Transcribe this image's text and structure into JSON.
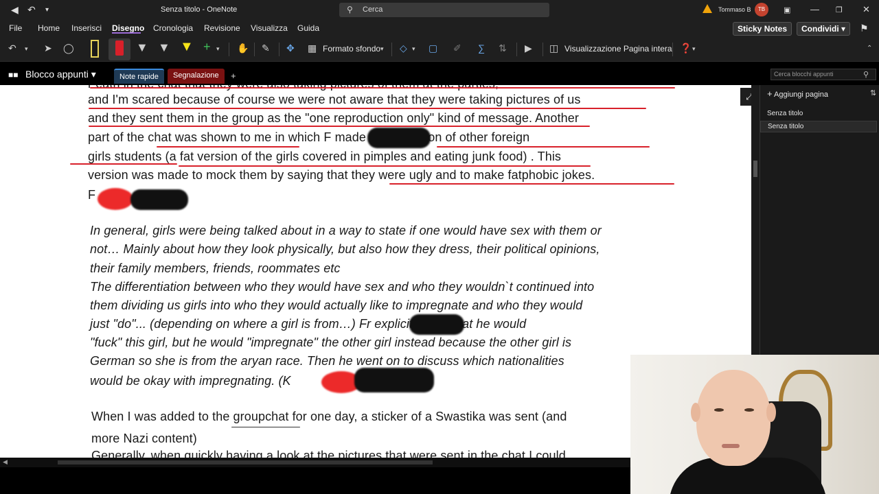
{
  "window": {
    "title": "Senza titolo - OneNote",
    "search_placeholder": "Cerca",
    "user_name": "Tommaso B",
    "user_initials": "TB"
  },
  "menu": {
    "items": [
      "File",
      "Home",
      "Inserisci",
      "Disegno",
      "Cronologia",
      "Revisione",
      "Visualizza",
      "Guida"
    ],
    "active": "Disegno",
    "sticky_notes": "Sticky Notes",
    "share": "Condividi"
  },
  "toolbar": {
    "background_format": "Formato sfondo",
    "full_page_view": "Visualizzazione Pagina intera",
    "pen_colors": [
      "#e8d45a",
      "#d8202a",
      "#f2f2f2",
      "#ffffff",
      "#f5e31a",
      "#3fbf5a"
    ]
  },
  "notebook": {
    "title": "Blocco appunti",
    "tabs": [
      {
        "label": "Note rapide",
        "color": "#1f3a55"
      },
      {
        "label": "Segnalazione",
        "color": "#7a1111"
      }
    ],
    "add_tab": "+",
    "search_placeholder": "Cerca blocchi appunti"
  },
  "pages_panel": {
    "add_page": "Aggiungi pagina",
    "pages": [
      "Senza titolo",
      "Senza titolo"
    ]
  },
  "document": {
    "lines": [
      "r eath in the chat that they were also taking pictures of them at the parties,",
      "and I'm scared because of course we were not aware that they were taking pictures of us",
      "and they sent them in the group as the \"one reproduction only\" kind of message. Another",
      "part of the chat was shown to me in which F               made an AI version of other foreign",
      "girls students (a fat version of the girls covered in pimples and eating junk food) . This",
      "version was made to mock them by saying that they were ugly and to make fatphobic jokes.",
      "F",
      "In general, girls were being talked about in a way to state if one would have sex with them or",
      "not… Mainly about how they look physically, but also how they dress, their political opinions,",
      "their family members, friends, roommates etc",
      "The differentiation between who they would have sex and who they wouldn`t continued into",
      "them dividing us girls into who they would actually like to impregnate and who they would",
      "just \"do\"... (depending on where a girl is from…) Fr              explicitly said that he would",
      "\"fuck\" this girl, but he would \"impregnate\" the other girl instead because the other girl is",
      "German so she is from the aryan race. Then he went on to discuss which nationalities",
      "would be okay with impregnating. (K",
      "When I was added to the groupchat for one day, a sticker of a Swastika was sent (and",
      "more Nazi content)",
      "Generally, when quickly having a look at the pictures that were sent in the chat I could"
    ]
  }
}
